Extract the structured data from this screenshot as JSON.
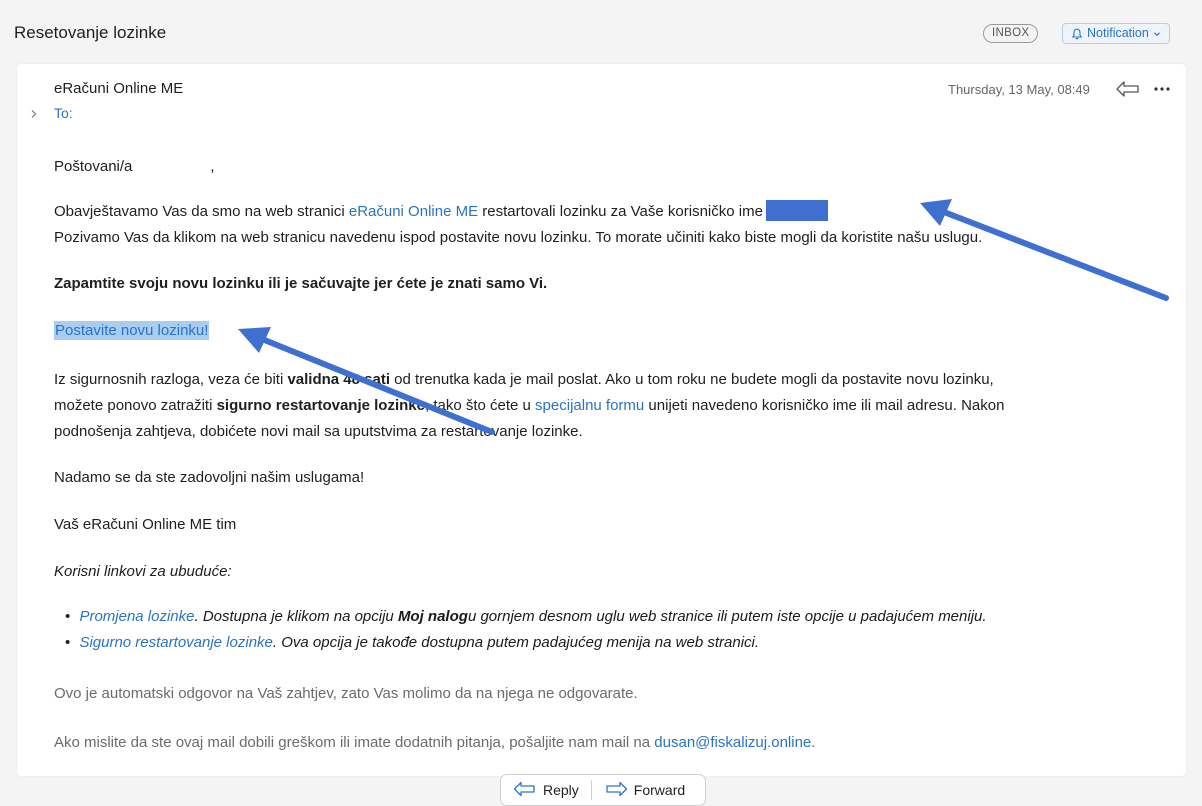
{
  "header": {
    "subject": "Resetovanje lozinke",
    "inbox_badge": "INBOX",
    "notification_label": "Notification"
  },
  "message": {
    "sender": "eRačuni Online ME",
    "to_label": "To:",
    "date": "Thursday, 13 May, 08:49",
    "greeting": "Poštovani/a",
    "greeting_comma": ",",
    "p1_a": "Obavještavamo Vas da smo na web stranici ",
    "p1_link": "eRačuni Online ME",
    "p1_b": " restartovali lozinku za Vaše korisničko ime",
    "p2": "Pozivamo Vas da klikom na web stranicu navedenu ispod postavite novu lozinku. To morate učiniti kako biste mogli da koristite našu uslugu.",
    "p3_bold": "Zapamtite svoju novu lozinku ili je sačuvajte jer ćete je znati samo Vi.",
    "reset_link": "Postavite novu lozinku!",
    "p4_l1_a": "Iz sigurnosnih razloga, veza će biti ",
    "p4_l1_bold": "validna 48 sati",
    "p4_l1_b": " od trenutka kada je mail poslat. Ako u tom roku ne budete mogli da postavite novu lozinku,",
    "p4_l2_a": "možete ponovo zatražiti ",
    "p4_l2_bold": "sigurno restartovanje lozinke",
    "p4_l2_b": ", tako što ćete u ",
    "p4_l2_link": "specijalnu formu",
    "p4_l2_c": " unijeti navedeno korisničko ime ili mail adresu. Nakon",
    "p4_l3": "podnošenja zahtjeva, dobićete novi mail sa uputstvima za restartovanje lozinke.",
    "p5": "Nadamo se da ste zadovoljni našim uslugama!",
    "p6": "Vaš eRačuni Online ME tim",
    "p7_italic": "Korisni linkovi za ubuduće:",
    "li1_link": "Promjena lozinke",
    "li1_a": ". Dostupna je klikom na opciju ",
    "li1_bold": "Moj nalog",
    "li1_b": "u gornjem desnom uglu web stranice ili putem iste opcije u padajućem meniju.",
    "li2_link": "Sigurno restartovanje lozinke",
    "li2_a": ". Ova opcija je takođe dostupna putem padajućeg menija na web stranici.",
    "p8": "Ovo je automatski odgovor na Vaš zahtjev, zato Vas molimo da na njega ne odgovarate.",
    "p9_a": "Ako mislite da ste ovaj mail dobili greškom ili imate dodatnih pitanja, pošaljite nam mail na ",
    "p9_link": "dusan@fiskalizuj.online",
    "p9_b": "."
  },
  "actions": {
    "reply_label": "Reply",
    "forward_label": "Forward"
  },
  "icons": {
    "bell": "bell-icon",
    "reply": "reply-icon",
    "forward": "forward-icon",
    "more": "more-icon",
    "chevron": "chevron-right-icon"
  },
  "colors": {
    "link": "#2a73c4",
    "highlight": "#a9cdf0",
    "annotation_arrow": "#3f6fcf",
    "redaction": "#3f6fcf"
  }
}
